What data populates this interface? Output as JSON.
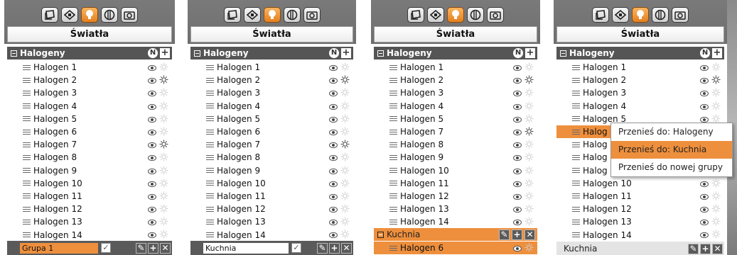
{
  "panels": [
    {
      "title": "Światła",
      "group": "Halogeny",
      "group_badge": "N",
      "items": [
        "Halogen 1",
        "Halogen 2",
        "Halogen 3",
        "Halogen 4",
        "Halogen 5",
        "Halogen 6",
        "Halogen 7",
        "Halogen 8",
        "Halogen 9",
        "Halogen 10",
        "Halogen 11",
        "Halogen 12",
        "Halogen 13",
        "Halogen 14"
      ],
      "lit_items": [
        "Halogen 2",
        "Halogen 7"
      ],
      "new_group_input": "Grupa 1"
    },
    {
      "title": "Światła",
      "group": "Halogeny",
      "group_badge": "N",
      "items": [
        "Halogen 1",
        "Halogen 2",
        "Halogen 3",
        "Halogen 4",
        "Halogen 5",
        "Halogen 6",
        "Halogen 7",
        "Halogen 8",
        "Halogen 9",
        "Halogen 10",
        "Halogen 11",
        "Halogen 12",
        "Halogen 13",
        "Halogen 14"
      ],
      "lit_items": [
        "Halogen 2",
        "Halogen 7"
      ],
      "new_group_input": "Kuchnia"
    },
    {
      "title": "Światła",
      "group": "Halogeny",
      "group_badge": "N",
      "items": [
        "Halogen 1",
        "Halogen 2",
        "Halogen 3",
        "Halogen 4",
        "Halogen 5",
        "Halogen 7",
        "Halogen 8",
        "Halogen 9",
        "Halogen 10",
        "Halogen 11",
        "Halogen 12",
        "Halogen 13",
        "Halogen 14"
      ],
      "lit_items": [
        "Halogen 2",
        "Halogen 7"
      ],
      "second_group": "Kuchnia",
      "second_group_items": [
        "Halogen 6"
      ]
    },
    {
      "title": "Światła",
      "group": "Halogeny",
      "group_badge": "N",
      "items": [
        "Halogen 1",
        "Halogen 2",
        "Halogen 3",
        "Halogen 4",
        "Halogen 5",
        "Halog",
        "Halog",
        "Halog",
        "Halog",
        "Halogen 10",
        "Halogen 11",
        "Halogen 12",
        "Halogen 13",
        "Halogen 14"
      ],
      "lit_items": [
        "Halogen 2"
      ],
      "selected_index": 5,
      "context_menu": [
        "Przenieś do: Halogeny",
        "Przenieś do: Kuchnia",
        "Przenieś do nowej grupy"
      ],
      "context_menu_highlighted": 1,
      "second_group": "Kuchnia"
    }
  ],
  "toolbar_icons": [
    "scenes-icon",
    "devices-icon",
    "lights-icon",
    "blinds-icon",
    "camera-icon"
  ],
  "active_icon": "lights-icon",
  "colors": {
    "accent": "#ee8f3d",
    "header": "#555555",
    "toolbar": "#757575"
  }
}
